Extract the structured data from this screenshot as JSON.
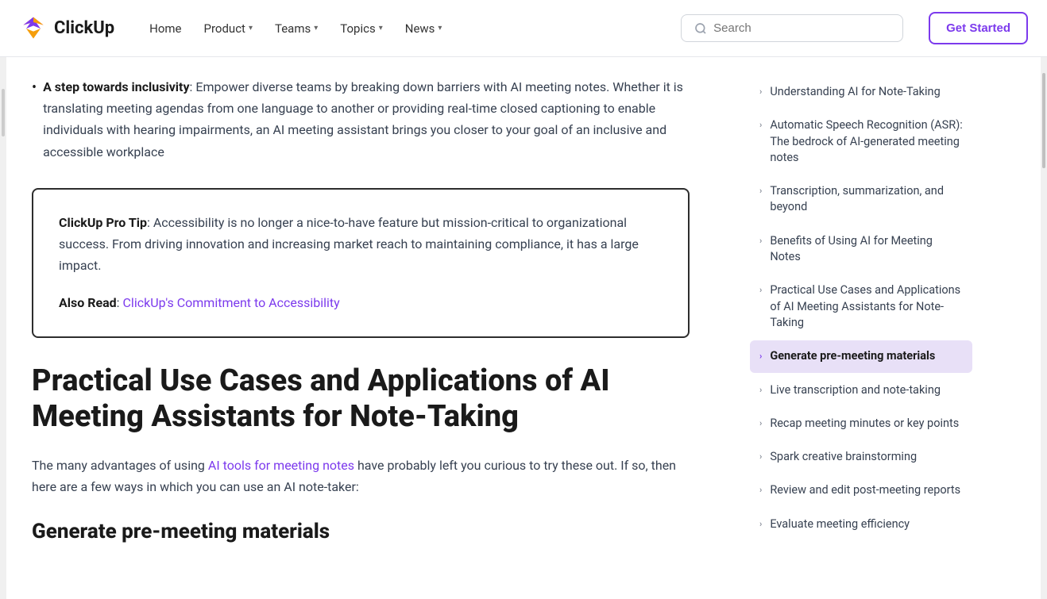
{
  "header": {
    "logo_text": "ClickUp",
    "nav_items": [
      {
        "label": "Home",
        "has_dropdown": false
      },
      {
        "label": "Product",
        "has_dropdown": true
      },
      {
        "label": "Teams",
        "has_dropdown": true
      },
      {
        "label": "Topics",
        "has_dropdown": true
      },
      {
        "label": "News",
        "has_dropdown": true
      }
    ],
    "search_placeholder": "Search",
    "cta_label": "Get Started"
  },
  "main": {
    "bullet_strong": "A step towards inclusivity",
    "bullet_text": ": Empower diverse teams by breaking down barriers with AI meeting notes. Whether it is translating meeting agendas from one language to another or providing real-time closed captioning to enable individuals with hearing impairments, an AI meeting assistant brings you closer to your goal of an inclusive and accessible workplace",
    "pro_tip_label": "ClickUp Pro Tip",
    "pro_tip_text": ": Accessibility is no longer a nice-to-have feature but mission-critical to organizational success. From driving innovation and increasing market reach to maintaining compliance, it has a large impact.",
    "also_read_label": "Also Read",
    "also_read_link_text": "ClickUp's Commitment to Accessibility",
    "section_heading": "Practical Use Cases and Applications of AI Meeting Assistants for Note-Taking",
    "body_paragraph": "The many advantages of using ",
    "body_link_text": "AI tools for meeting notes",
    "body_paragraph_end": " have probably left you curious to try these out. If so, then here are a few ways in which you can use an AI note-taker:",
    "sub_heading": "Generate pre-meeting materials"
  },
  "sidebar": {
    "items": [
      {
        "label": "Understanding AI for Note-Taking",
        "active": false
      },
      {
        "label": "Automatic Speech Recognition (ASR): The bedrock of AI-generated meeting notes",
        "active": false
      },
      {
        "label": "Transcription, summarization, and beyond",
        "active": false
      },
      {
        "label": "Benefits of Using AI for Meeting Notes",
        "active": false
      },
      {
        "label": "Practical Use Cases and Applications of AI Meeting Assistants for Note-Taking",
        "active": false
      },
      {
        "label": "Generate pre-meeting materials",
        "active": true
      },
      {
        "label": "Live transcription and note-taking",
        "active": false
      },
      {
        "label": "Recap meeting minutes or key points",
        "active": false
      },
      {
        "label": "Spark creative brainstorming",
        "active": false
      },
      {
        "label": "Review and edit post-meeting reports",
        "active": false
      },
      {
        "label": "Evaluate meeting efficiency",
        "active": false
      }
    ]
  }
}
